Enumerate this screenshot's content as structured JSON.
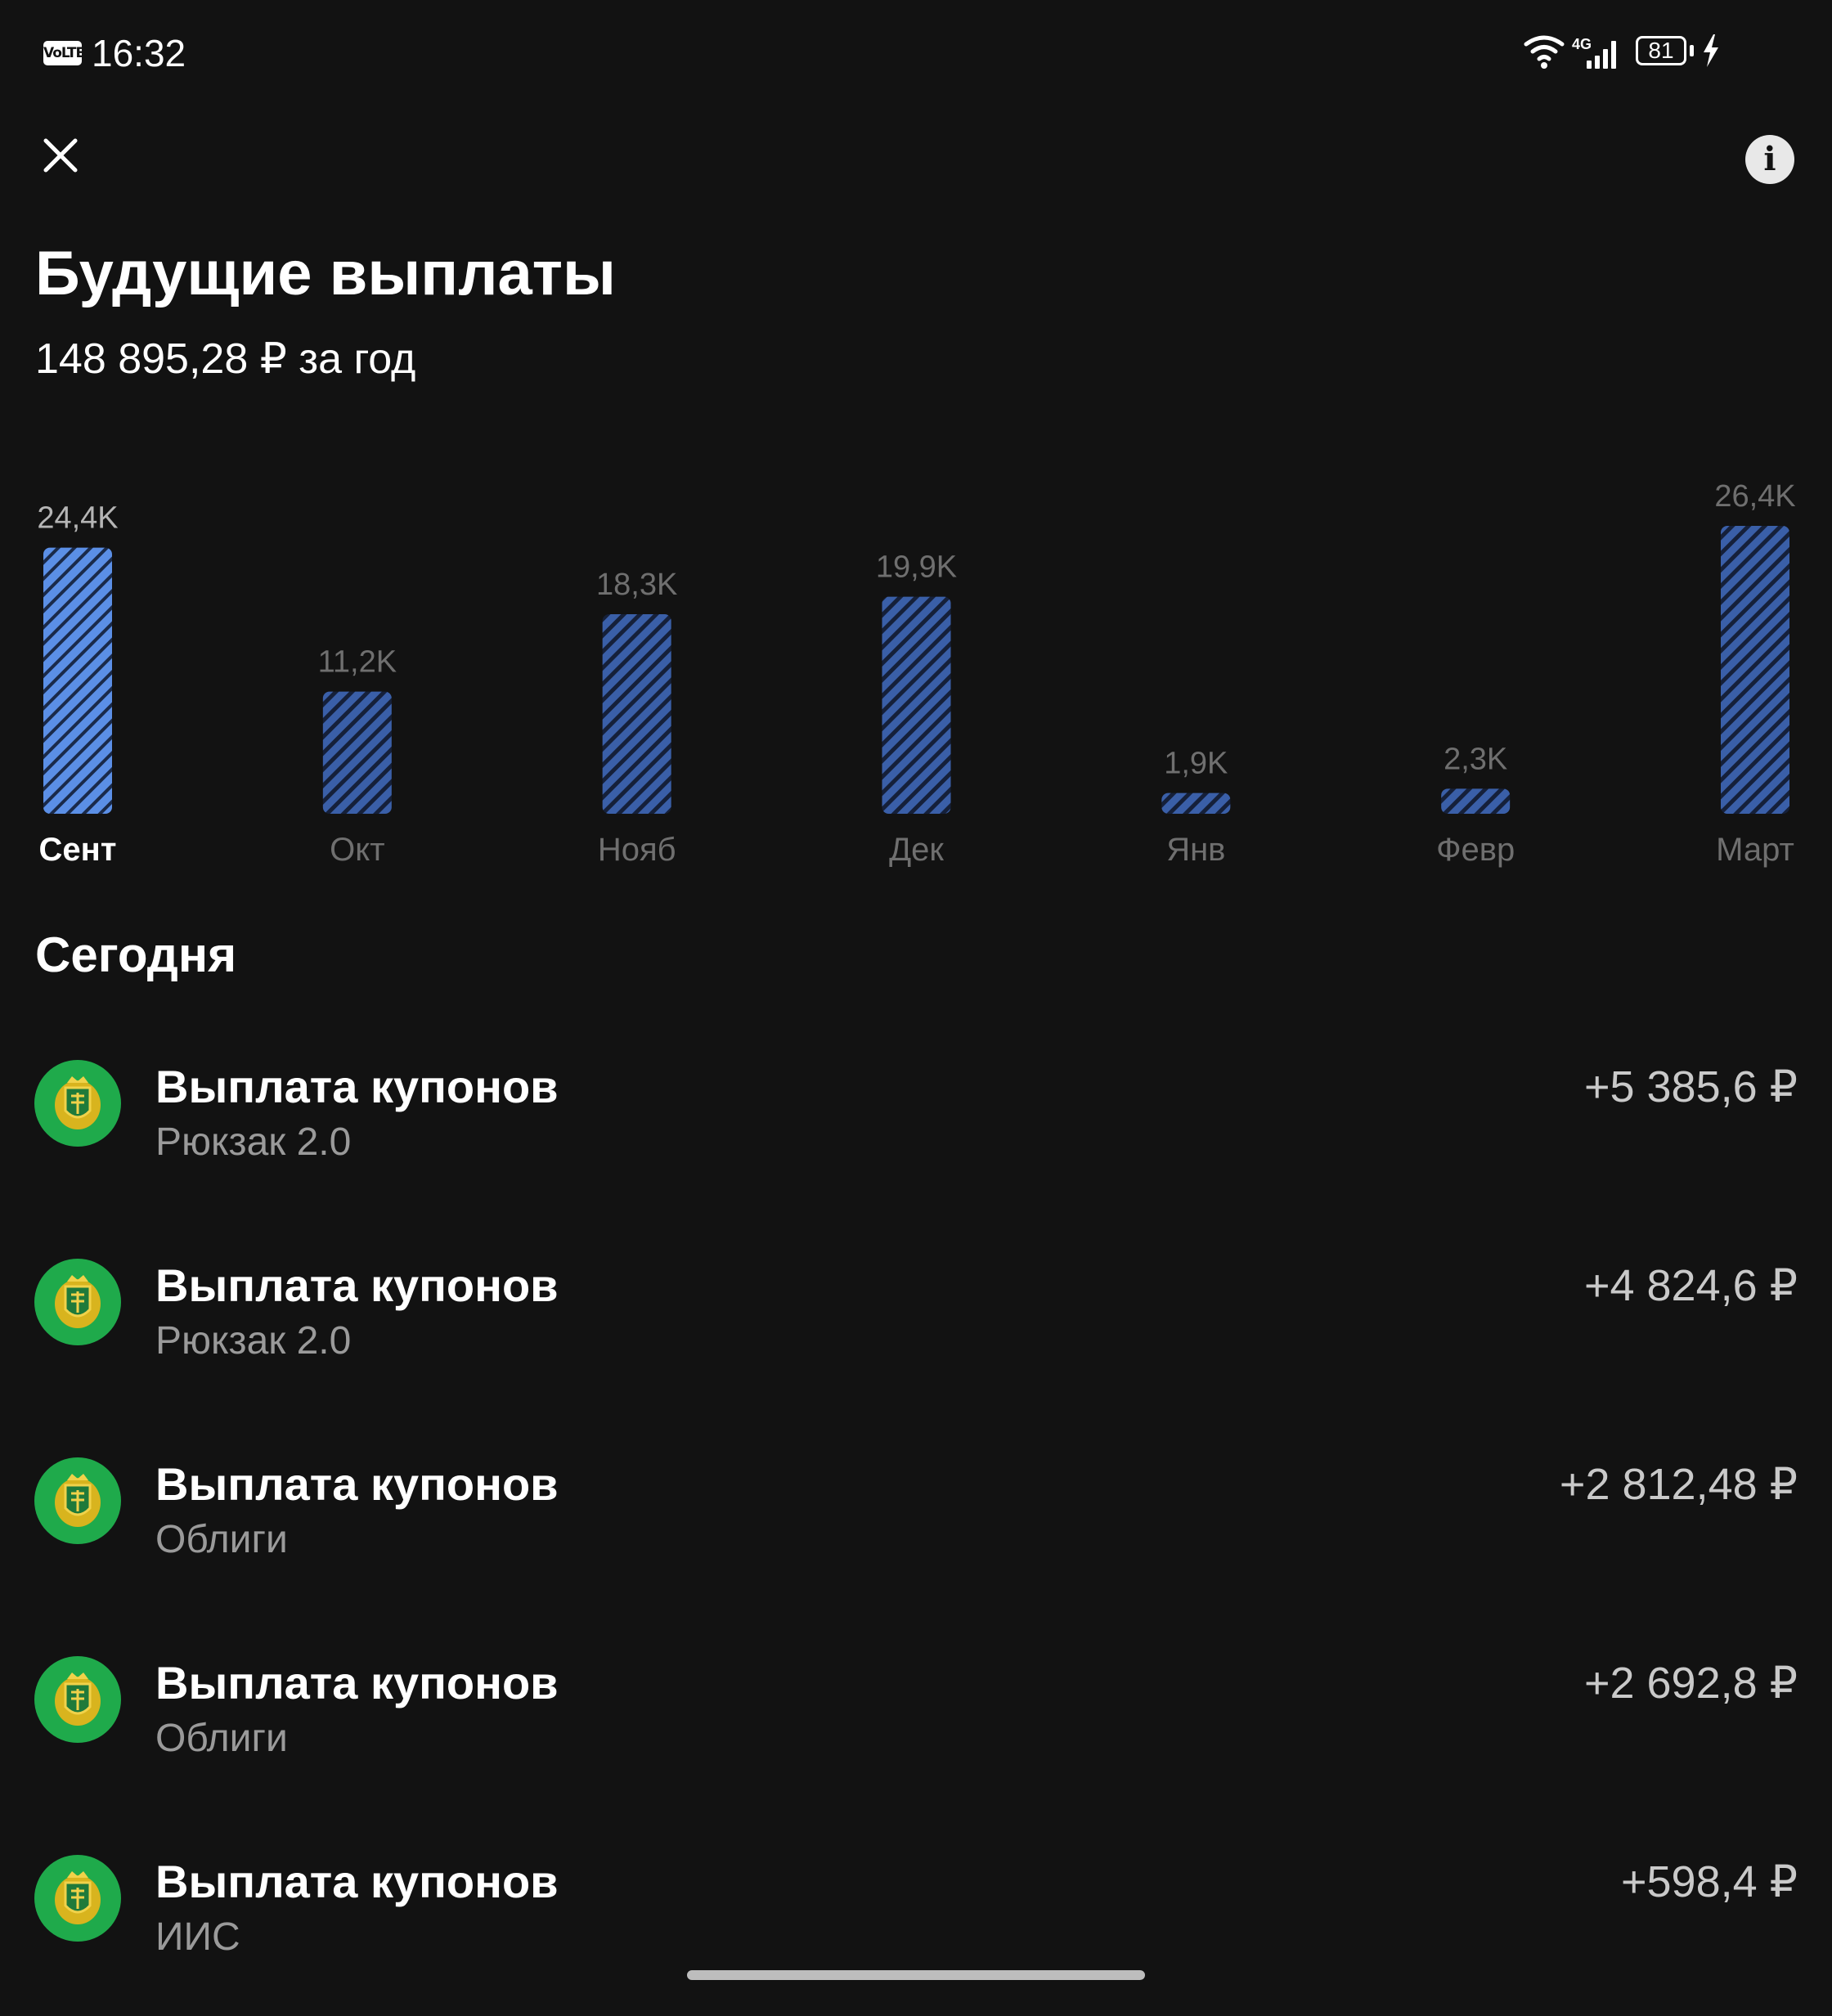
{
  "status_bar": {
    "volte_label": "VoLTE",
    "time": "16:32",
    "network_label": "4G",
    "battery_level": "81"
  },
  "header": {
    "title": "Будущие выплаты",
    "subtitle": "148 895,28 ₽ за год"
  },
  "icons": {
    "close": "close-icon",
    "info": "info-icon",
    "avatar": "coat-of-arms-icon"
  },
  "colors": {
    "background": "#121212",
    "bar_selected": "#5b8fe6",
    "bar_default": "#3a5fa8",
    "avatar_bg": "#1faa4b",
    "muted_text": "#9a9a9a"
  },
  "chart_data": {
    "type": "bar",
    "categories": [
      "Сент",
      "Окт",
      "Нояб",
      "Дек",
      "Янв",
      "Февр",
      "Март"
    ],
    "values": [
      24.4,
      11.2,
      18.3,
      19.9,
      1.9,
      2.3,
      26.4
    ],
    "value_labels": [
      "24,4K",
      "11,2K",
      "18,3K",
      "19,9K",
      "1,9K",
      "2,3K",
      "26,4K"
    ],
    "selected_index": 0,
    "ylim": [
      0,
      26.4
    ],
    "grid": false,
    "title": ""
  },
  "section": {
    "title": "Сегодня"
  },
  "payments": [
    {
      "title": "Выплата купонов",
      "subtitle": "Рюкзак 2.0",
      "amount": "+5 385,6 ₽"
    },
    {
      "title": "Выплата купонов",
      "subtitle": "Рюкзак 2.0",
      "amount": "+4 824,6 ₽"
    },
    {
      "title": "Выплата купонов",
      "subtitle": "Облиги",
      "amount": "+2 812,48 ₽"
    },
    {
      "title": "Выплата купонов",
      "subtitle": "Облиги",
      "amount": "+2 692,8 ₽"
    },
    {
      "title": "Выплата купонов",
      "subtitle": "ИИС",
      "amount": "+598,4 ₽"
    }
  ]
}
